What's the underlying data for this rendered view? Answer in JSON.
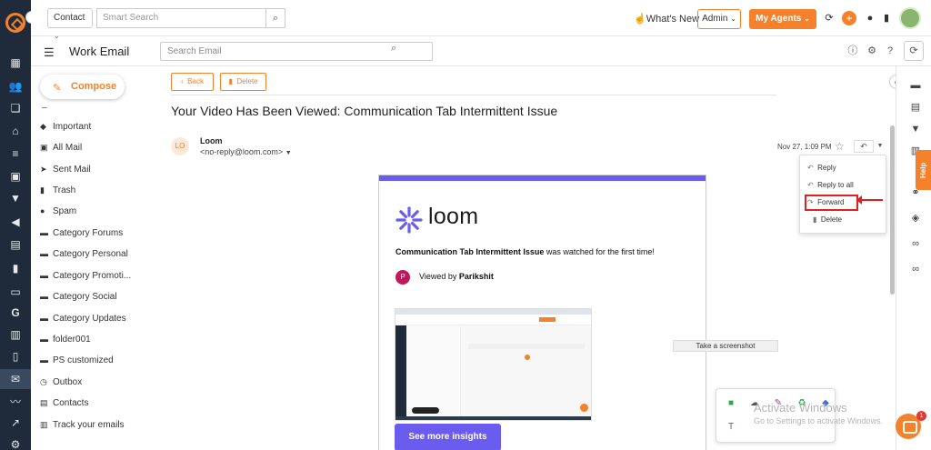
{
  "topbar": {
    "contact_label": "Contact",
    "smart_search_placeholder": "Smart Search",
    "whats_new": "What's New",
    "admin_label": "Admin",
    "my_agents_label": "My Agents"
  },
  "subheader": {
    "title": "Work Email",
    "search_placeholder": "Search Email"
  },
  "sidebar": {
    "compose_label": "Compose",
    "dash": "–",
    "folders": [
      {
        "label": "Important",
        "icon": "tag-icon"
      },
      {
        "label": "All Mail",
        "icon": "inbox-icon"
      },
      {
        "label": "Sent Mail",
        "icon": "send-icon"
      },
      {
        "label": "Trash",
        "icon": "trash-icon"
      },
      {
        "label": "Spam",
        "icon": "spam-icon"
      },
      {
        "label": "Category Forums",
        "icon": "folder-icon"
      },
      {
        "label": "Category Personal",
        "icon": "folder-icon"
      },
      {
        "label": "Category Promoti...",
        "icon": "folder-icon"
      },
      {
        "label": "Category Social",
        "icon": "folder-icon"
      },
      {
        "label": "Category Updates",
        "icon": "folder-icon"
      },
      {
        "label": "folder001",
        "icon": "folder-icon"
      },
      {
        "label": "PS customized",
        "icon": "folder-icon"
      },
      {
        "label": "Outbox",
        "icon": "outbox-icon"
      },
      {
        "label": "Contacts",
        "icon": "contacts-icon"
      },
      {
        "label": "Track your emails",
        "icon": "track-icon"
      }
    ]
  },
  "toolbar": {
    "back_label": "Back",
    "delete_label": "Delete"
  },
  "email": {
    "subject": "Your Video Has Been Viewed: Communication Tab Intermittent Issue",
    "sender_initials": "LO",
    "sender_name": "Loom",
    "sender_email": "<no-reply@loom.com>",
    "date": "Nov 27, 1:09 PM",
    "body": {
      "brand": "loom",
      "watched_bold": "Communication Tab Intermittent Issue",
      "watched_rest": " was watched for the first time!",
      "viewer_initial": "P",
      "viewed_by_prefix": "Viewed by ",
      "viewer_name": "Parikshit",
      "cta": "See more insights"
    }
  },
  "reply_menu": {
    "reply": "Reply",
    "reply_all": "Reply to all",
    "forward": "Forward",
    "delete": "Delete"
  },
  "tooltip": "Take a screenshot",
  "help_label": "Help",
  "activate_windows": {
    "title": "Activate Windows",
    "subtitle": "Go to Settings to activate Windows."
  },
  "chat_badge": "1",
  "colors": {
    "accent": "#f5812a",
    "rail_bg": "#1f2b3a",
    "loom_purple": "#6b5cf0",
    "highlight_red": "#e02020"
  }
}
